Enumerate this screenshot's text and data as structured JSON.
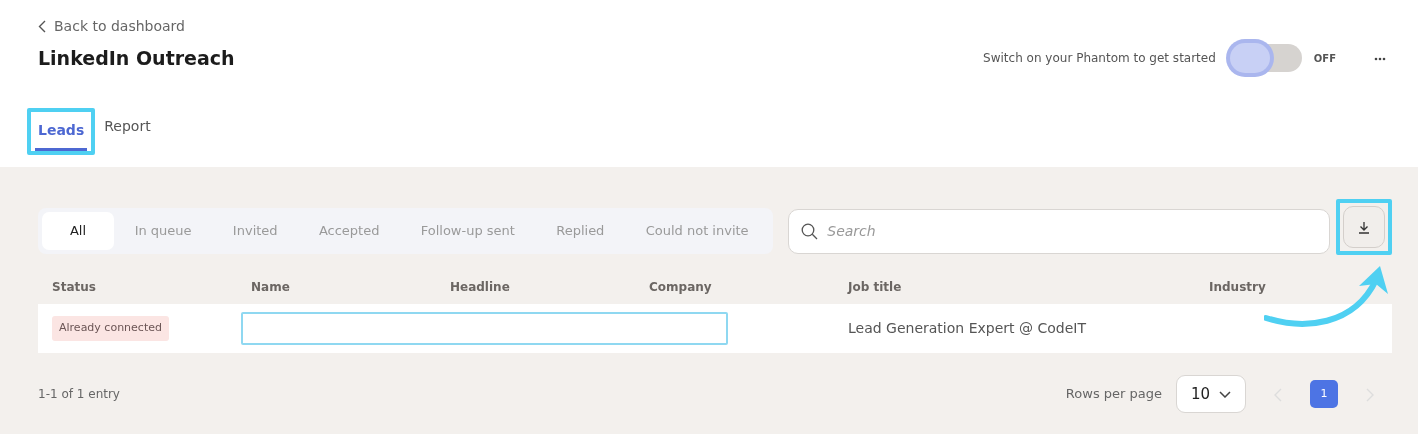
{
  "back_link": "Back to dashboard",
  "title": "LinkedIn Outreach",
  "phantom_switch": {
    "label": "Switch on your Phantom to get started",
    "on": false,
    "state_label": "OFF"
  },
  "tabs": [
    {
      "label": "Leads",
      "selected": true
    },
    {
      "label": "Report",
      "selected": false
    }
  ],
  "filters": [
    {
      "label": "All",
      "selected": true
    },
    {
      "label": "In queue",
      "selected": false
    },
    {
      "label": "Invited",
      "selected": false
    },
    {
      "label": "Accepted",
      "selected": false
    },
    {
      "label": "Follow-up sent",
      "selected": false
    },
    {
      "label": "Replied",
      "selected": false
    },
    {
      "label": "Could not invite",
      "selected": false
    }
  ],
  "search": {
    "placeholder": "Search"
  },
  "table": {
    "columns": [
      "Status",
      "Name",
      "Headline",
      "Company",
      "Job title",
      "Industry"
    ],
    "rows": [
      {
        "status": "Already connected",
        "job_title": "Lead Generation Expert @ CodeIT"
      }
    ]
  },
  "footer": {
    "entries": "1-1 of 1 entry",
    "rows_per_page_label": "Rows per page",
    "rows_per_page": "10",
    "pages": [
      {
        "label": "1",
        "selected": true
      }
    ]
  }
}
